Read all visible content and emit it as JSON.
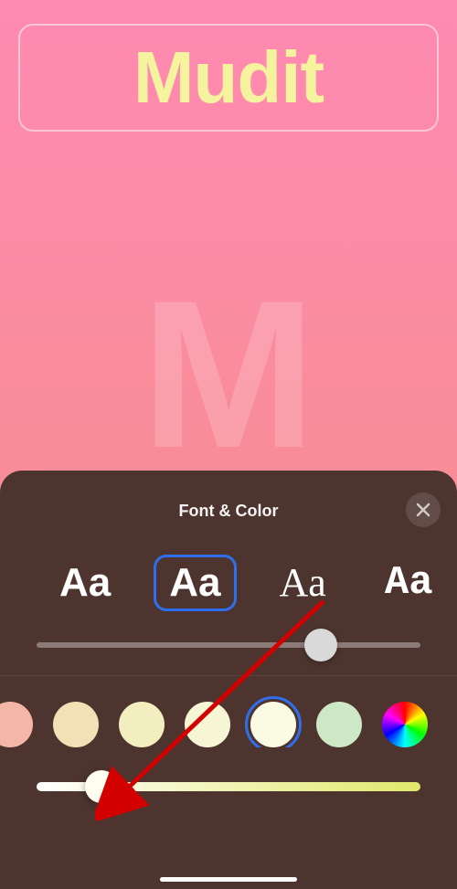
{
  "wallpaper": {
    "name": "Mudit",
    "monogram": "M"
  },
  "panel": {
    "title": "Font & Color",
    "fonts": [
      {
        "label": "Aa",
        "class": "font-sans",
        "selected": false
      },
      {
        "label": "Aa",
        "class": "font-sans",
        "selected": true
      },
      {
        "label": "Aa",
        "class": "font-serif",
        "selected": false
      },
      {
        "label": "Aa",
        "class": "font-mono",
        "selected": false
      }
    ],
    "weight_slider": {
      "value": 74
    },
    "colors": [
      {
        "hex": "#f4b6a6",
        "selected": false
      },
      {
        "hex": "#f3e0b6",
        "selected": false
      },
      {
        "hex": "#f2eec0",
        "selected": false
      },
      {
        "hex": "#f6f6d4",
        "selected": false
      },
      {
        "hex": "#fbfbe3",
        "selected": true
      },
      {
        "hex": "#cde8c5",
        "selected": false
      },
      {
        "type": "wheel",
        "selected": false
      }
    ],
    "tint_slider": {
      "value": 17,
      "gradient_from": "#ffffff",
      "gradient_to": "#e0e86b"
    }
  }
}
